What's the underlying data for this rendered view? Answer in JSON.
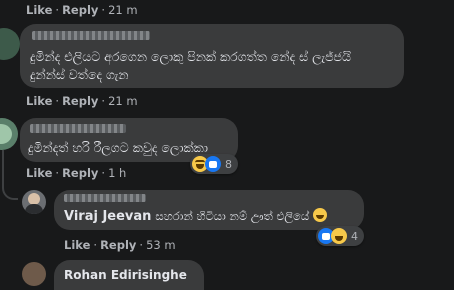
{
  "top_meta": {
    "like": "Like",
    "reply": "Reply",
    "time": "21 m"
  },
  "comment1": {
    "line1": "දුමින්ද එලියට අරගෙන ලොකු පිනක් කරගත්ත නේද ස් ලැජ්ජයි",
    "line2": "දුන්න්ස් වත්දෙ ගැන",
    "meta": {
      "like": "Like",
      "reply": "Reply",
      "time": "21 m"
    }
  },
  "comment2": {
    "author": "Viraj Jeevan",
    "text": "දුමින්දත් හරි රීලගට කවුද ලොක්කා",
    "meta": {
      "like": "Like",
      "reply": "Reply",
      "time": "1 h"
    },
    "reaction_count": "8"
  },
  "reply1": {
    "mention": "Viraj Jeevan",
    "text": "සහරාන් හිටියා නම් ඌත් එලියේ",
    "meta": {
      "like": "Like",
      "reply": "Reply",
      "time": "53 m"
    },
    "reaction_count": "4"
  },
  "comment3": {
    "author": "Rohan Edirisinghe"
  },
  "colors": {
    "background": "#18191a",
    "bubble": "#3a3b3c",
    "like_blue": "#1877f2",
    "haha_yellow": "#f7c94a"
  }
}
